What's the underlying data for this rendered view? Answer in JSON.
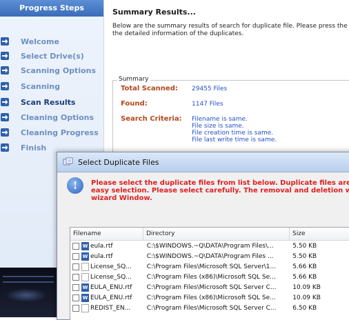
{
  "sidebar": {
    "header": "Progress Steps",
    "steps": [
      {
        "label": "Welcome"
      },
      {
        "label": "Select Drive(s)"
      },
      {
        "label": "Scanning Options"
      },
      {
        "label": "Scanning"
      },
      {
        "label": "Scan Results"
      },
      {
        "label": "Cleaning Options"
      },
      {
        "label": "Cleaning Progress"
      },
      {
        "label": "Finish"
      }
    ]
  },
  "main": {
    "title": "Summary Results...",
    "description_line1": "Below are the summary results of search for duplicate file. Please press the",
    "description_line2": "the detailed information of the duplicates.",
    "summary": {
      "group_label": "Summary",
      "total_scanned_label": "Total Scanned:",
      "total_scanned_value": "29455 Files",
      "found_label": "Found:",
      "found_value": "1147 Files",
      "criteria_label": "Search Criteria:",
      "criteria": [
        "Filename is same.",
        "File size is same.",
        "File creation time is same.",
        "File last write time is same."
      ]
    }
  },
  "dialog": {
    "title": "Select Duplicate Files",
    "warning_line1": "Please select the duplicate files from list below. Duplicate files are gro",
    "warning_line2": "easy selection. Please select carefully. The removal and deletion will t",
    "warning_line3": "wizard Window.",
    "columns": [
      "Filename",
      "Directory",
      "Size"
    ],
    "rows": [
      {
        "filename": "eula.rtf",
        "icon": "word-doc-icon",
        "directory": "C:\\$WINDOWS.~Q\\DATA\\Program Files\\...",
        "size": "5.50 KB"
      },
      {
        "filename": "eula.rtf",
        "icon": "word-doc-icon",
        "directory": "C:\\$WINDOWS.~Q\\DATA\\Program Files ...",
        "size": "5.50 KB"
      },
      {
        "filename": "License_SQ...",
        "icon": "text-doc-icon",
        "directory": "C:\\Program Files\\Microsoft SQL Server\\1...",
        "size": "5.66 KB"
      },
      {
        "filename": "License_SQ...",
        "icon": "text-doc-icon",
        "directory": "C:\\Program Files (x86)\\Microsoft SQL Se...",
        "size": "5.66 KB"
      },
      {
        "filename": "EULA_ENU.rtf",
        "icon": "word-doc-icon",
        "directory": "C:\\Program Files\\Microsoft SQL Server C...",
        "size": "10.09 KB"
      },
      {
        "filename": "EULA_ENU.rtf",
        "icon": "word-doc-icon",
        "directory": "C:\\Program Files (x86)\\Microsoft SQL Se...",
        "size": "10.09 KB"
      },
      {
        "filename": "REDIST_EN...",
        "icon": "text-doc-icon",
        "directory": "C:\\Program Files\\Microsoft SQL Server C...",
        "size": "6.50 KB"
      }
    ]
  }
}
